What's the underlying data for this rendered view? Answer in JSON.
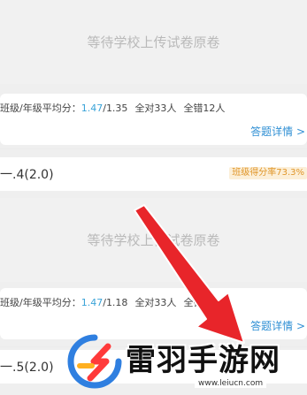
{
  "items": [
    {
      "placeholder_text": "等待学校上传试卷原卷",
      "stats": {
        "label": "班级/年级平均分：",
        "class_avg": "1.47",
        "separator": "/",
        "grade_avg": "1.35",
        "all_correct": "全对33人",
        "all_wrong": "全错12人"
      },
      "detail_link": "答题详情 >",
      "question_label": "一.4(2.0)",
      "rate_badge": "班级得分率73.3%"
    },
    {
      "placeholder_text": "等待学校上传试卷原卷",
      "stats": {
        "label": "班级/年级平均分：",
        "class_avg": "1.47",
        "separator": "/",
        "grade_avg": "1.18",
        "all_correct": "全对33人",
        "all_wrong": "全错"
      },
      "detail_link": "答题详情 >",
      "question_label": "一.5(2.0)",
      "rate_badge": ""
    }
  ],
  "watermark": {
    "title": "雷羽手游网",
    "url": "www.leiucn.com"
  },
  "colors": {
    "accent_blue": "#3aa3d8",
    "link_blue": "#2f8fd4",
    "badge_orange": "#e0962a",
    "arrow_red": "#e8252a"
  }
}
